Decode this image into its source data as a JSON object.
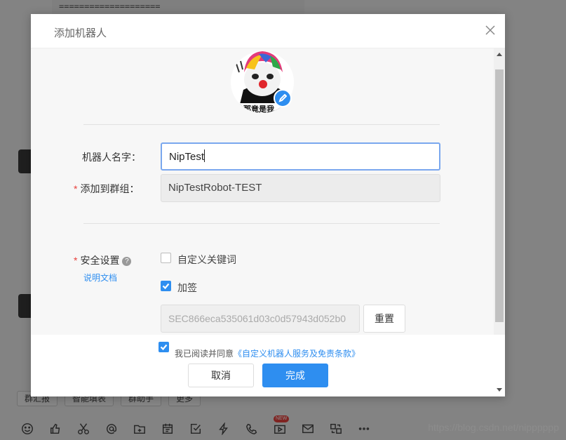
{
  "background": {
    "code_line": "====================",
    "chips": [
      "群汇报",
      "智能填表",
      "群助手",
      "更多"
    ],
    "toolbar_icons": [
      "emoji-icon",
      "thumbs-up-icon",
      "scissors-icon",
      "at-icon",
      "folder-add-icon",
      "calendar-icon",
      "checkbox-icon",
      "lightning-icon",
      "phone-icon",
      "video-icon",
      "mail-icon",
      "switch-icon",
      "more-icon"
    ],
    "new_badge": "NEW",
    "watermark": "https://blog.csdn.net/nipppppp"
  },
  "dialog": {
    "title": "添加机器人",
    "close_icon": "close-icon",
    "avatar_caption": "那竟是我",
    "robot_name_label": "机器人名字：",
    "robot_name_value": "NipTest",
    "group_label": "添加到群组：",
    "group_value": "NipTestRobot-TEST",
    "security_label": "安全设置",
    "help_mark": "?",
    "doc_link": "说明文档",
    "keyword_option": "自定义关键词",
    "keyword_checked": false,
    "sign_option": "加签",
    "sign_checked": true,
    "secret_value": "SEC866eca535061d03c0d57943d052b0",
    "reset_button": "重置",
    "agree_prefix": "我已阅读并同意",
    "agree_link": "《自定义机器人服务及免责条款》",
    "agree_checked": true,
    "cancel_button": "取消",
    "confirm_button": "完成"
  },
  "colors": {
    "accent": "#2e8ef0",
    "required": "#e8403c",
    "focus_border": "#7aa7ee"
  }
}
